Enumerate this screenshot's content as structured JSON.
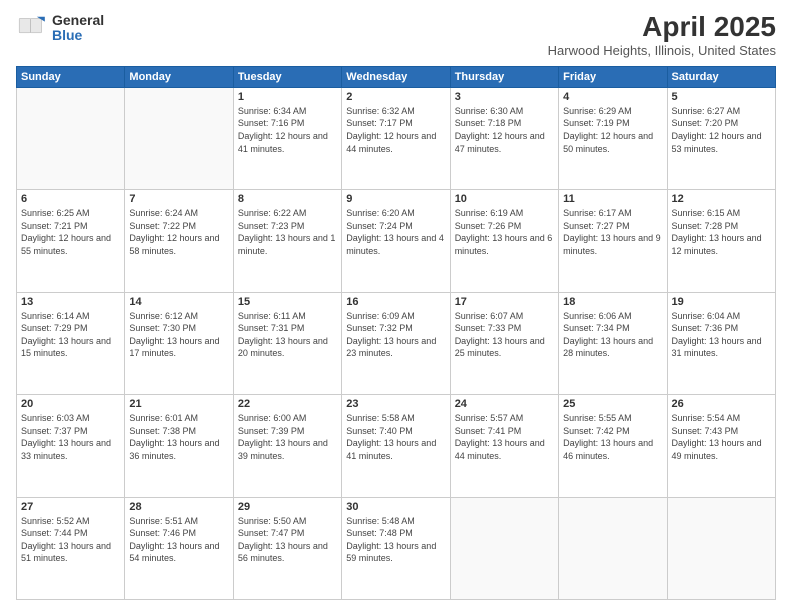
{
  "logo": {
    "general": "General",
    "blue": "Blue"
  },
  "title": "April 2025",
  "subtitle": "Harwood Heights, Illinois, United States",
  "headers": [
    "Sunday",
    "Monday",
    "Tuesday",
    "Wednesday",
    "Thursday",
    "Friday",
    "Saturday"
  ],
  "weeks": [
    [
      {
        "day": "",
        "info": ""
      },
      {
        "day": "",
        "info": ""
      },
      {
        "day": "1",
        "info": "Sunrise: 6:34 AM\nSunset: 7:16 PM\nDaylight: 12 hours and 41 minutes."
      },
      {
        "day": "2",
        "info": "Sunrise: 6:32 AM\nSunset: 7:17 PM\nDaylight: 12 hours and 44 minutes."
      },
      {
        "day": "3",
        "info": "Sunrise: 6:30 AM\nSunset: 7:18 PM\nDaylight: 12 hours and 47 minutes."
      },
      {
        "day": "4",
        "info": "Sunrise: 6:29 AM\nSunset: 7:19 PM\nDaylight: 12 hours and 50 minutes."
      },
      {
        "day": "5",
        "info": "Sunrise: 6:27 AM\nSunset: 7:20 PM\nDaylight: 12 hours and 53 minutes."
      }
    ],
    [
      {
        "day": "6",
        "info": "Sunrise: 6:25 AM\nSunset: 7:21 PM\nDaylight: 12 hours and 55 minutes."
      },
      {
        "day": "7",
        "info": "Sunrise: 6:24 AM\nSunset: 7:22 PM\nDaylight: 12 hours and 58 minutes."
      },
      {
        "day": "8",
        "info": "Sunrise: 6:22 AM\nSunset: 7:23 PM\nDaylight: 13 hours and 1 minute."
      },
      {
        "day": "9",
        "info": "Sunrise: 6:20 AM\nSunset: 7:24 PM\nDaylight: 13 hours and 4 minutes."
      },
      {
        "day": "10",
        "info": "Sunrise: 6:19 AM\nSunset: 7:26 PM\nDaylight: 13 hours and 6 minutes."
      },
      {
        "day": "11",
        "info": "Sunrise: 6:17 AM\nSunset: 7:27 PM\nDaylight: 13 hours and 9 minutes."
      },
      {
        "day": "12",
        "info": "Sunrise: 6:15 AM\nSunset: 7:28 PM\nDaylight: 13 hours and 12 minutes."
      }
    ],
    [
      {
        "day": "13",
        "info": "Sunrise: 6:14 AM\nSunset: 7:29 PM\nDaylight: 13 hours and 15 minutes."
      },
      {
        "day": "14",
        "info": "Sunrise: 6:12 AM\nSunset: 7:30 PM\nDaylight: 13 hours and 17 minutes."
      },
      {
        "day": "15",
        "info": "Sunrise: 6:11 AM\nSunset: 7:31 PM\nDaylight: 13 hours and 20 minutes."
      },
      {
        "day": "16",
        "info": "Sunrise: 6:09 AM\nSunset: 7:32 PM\nDaylight: 13 hours and 23 minutes."
      },
      {
        "day": "17",
        "info": "Sunrise: 6:07 AM\nSunset: 7:33 PM\nDaylight: 13 hours and 25 minutes."
      },
      {
        "day": "18",
        "info": "Sunrise: 6:06 AM\nSunset: 7:34 PM\nDaylight: 13 hours and 28 minutes."
      },
      {
        "day": "19",
        "info": "Sunrise: 6:04 AM\nSunset: 7:36 PM\nDaylight: 13 hours and 31 minutes."
      }
    ],
    [
      {
        "day": "20",
        "info": "Sunrise: 6:03 AM\nSunset: 7:37 PM\nDaylight: 13 hours and 33 minutes."
      },
      {
        "day": "21",
        "info": "Sunrise: 6:01 AM\nSunset: 7:38 PM\nDaylight: 13 hours and 36 minutes."
      },
      {
        "day": "22",
        "info": "Sunrise: 6:00 AM\nSunset: 7:39 PM\nDaylight: 13 hours and 39 minutes."
      },
      {
        "day": "23",
        "info": "Sunrise: 5:58 AM\nSunset: 7:40 PM\nDaylight: 13 hours and 41 minutes."
      },
      {
        "day": "24",
        "info": "Sunrise: 5:57 AM\nSunset: 7:41 PM\nDaylight: 13 hours and 44 minutes."
      },
      {
        "day": "25",
        "info": "Sunrise: 5:55 AM\nSunset: 7:42 PM\nDaylight: 13 hours and 46 minutes."
      },
      {
        "day": "26",
        "info": "Sunrise: 5:54 AM\nSunset: 7:43 PM\nDaylight: 13 hours and 49 minutes."
      }
    ],
    [
      {
        "day": "27",
        "info": "Sunrise: 5:52 AM\nSunset: 7:44 PM\nDaylight: 13 hours and 51 minutes."
      },
      {
        "day": "28",
        "info": "Sunrise: 5:51 AM\nSunset: 7:46 PM\nDaylight: 13 hours and 54 minutes."
      },
      {
        "day": "29",
        "info": "Sunrise: 5:50 AM\nSunset: 7:47 PM\nDaylight: 13 hours and 56 minutes."
      },
      {
        "day": "30",
        "info": "Sunrise: 5:48 AM\nSunset: 7:48 PM\nDaylight: 13 hours and 59 minutes."
      },
      {
        "day": "",
        "info": ""
      },
      {
        "day": "",
        "info": ""
      },
      {
        "day": "",
        "info": ""
      }
    ]
  ]
}
